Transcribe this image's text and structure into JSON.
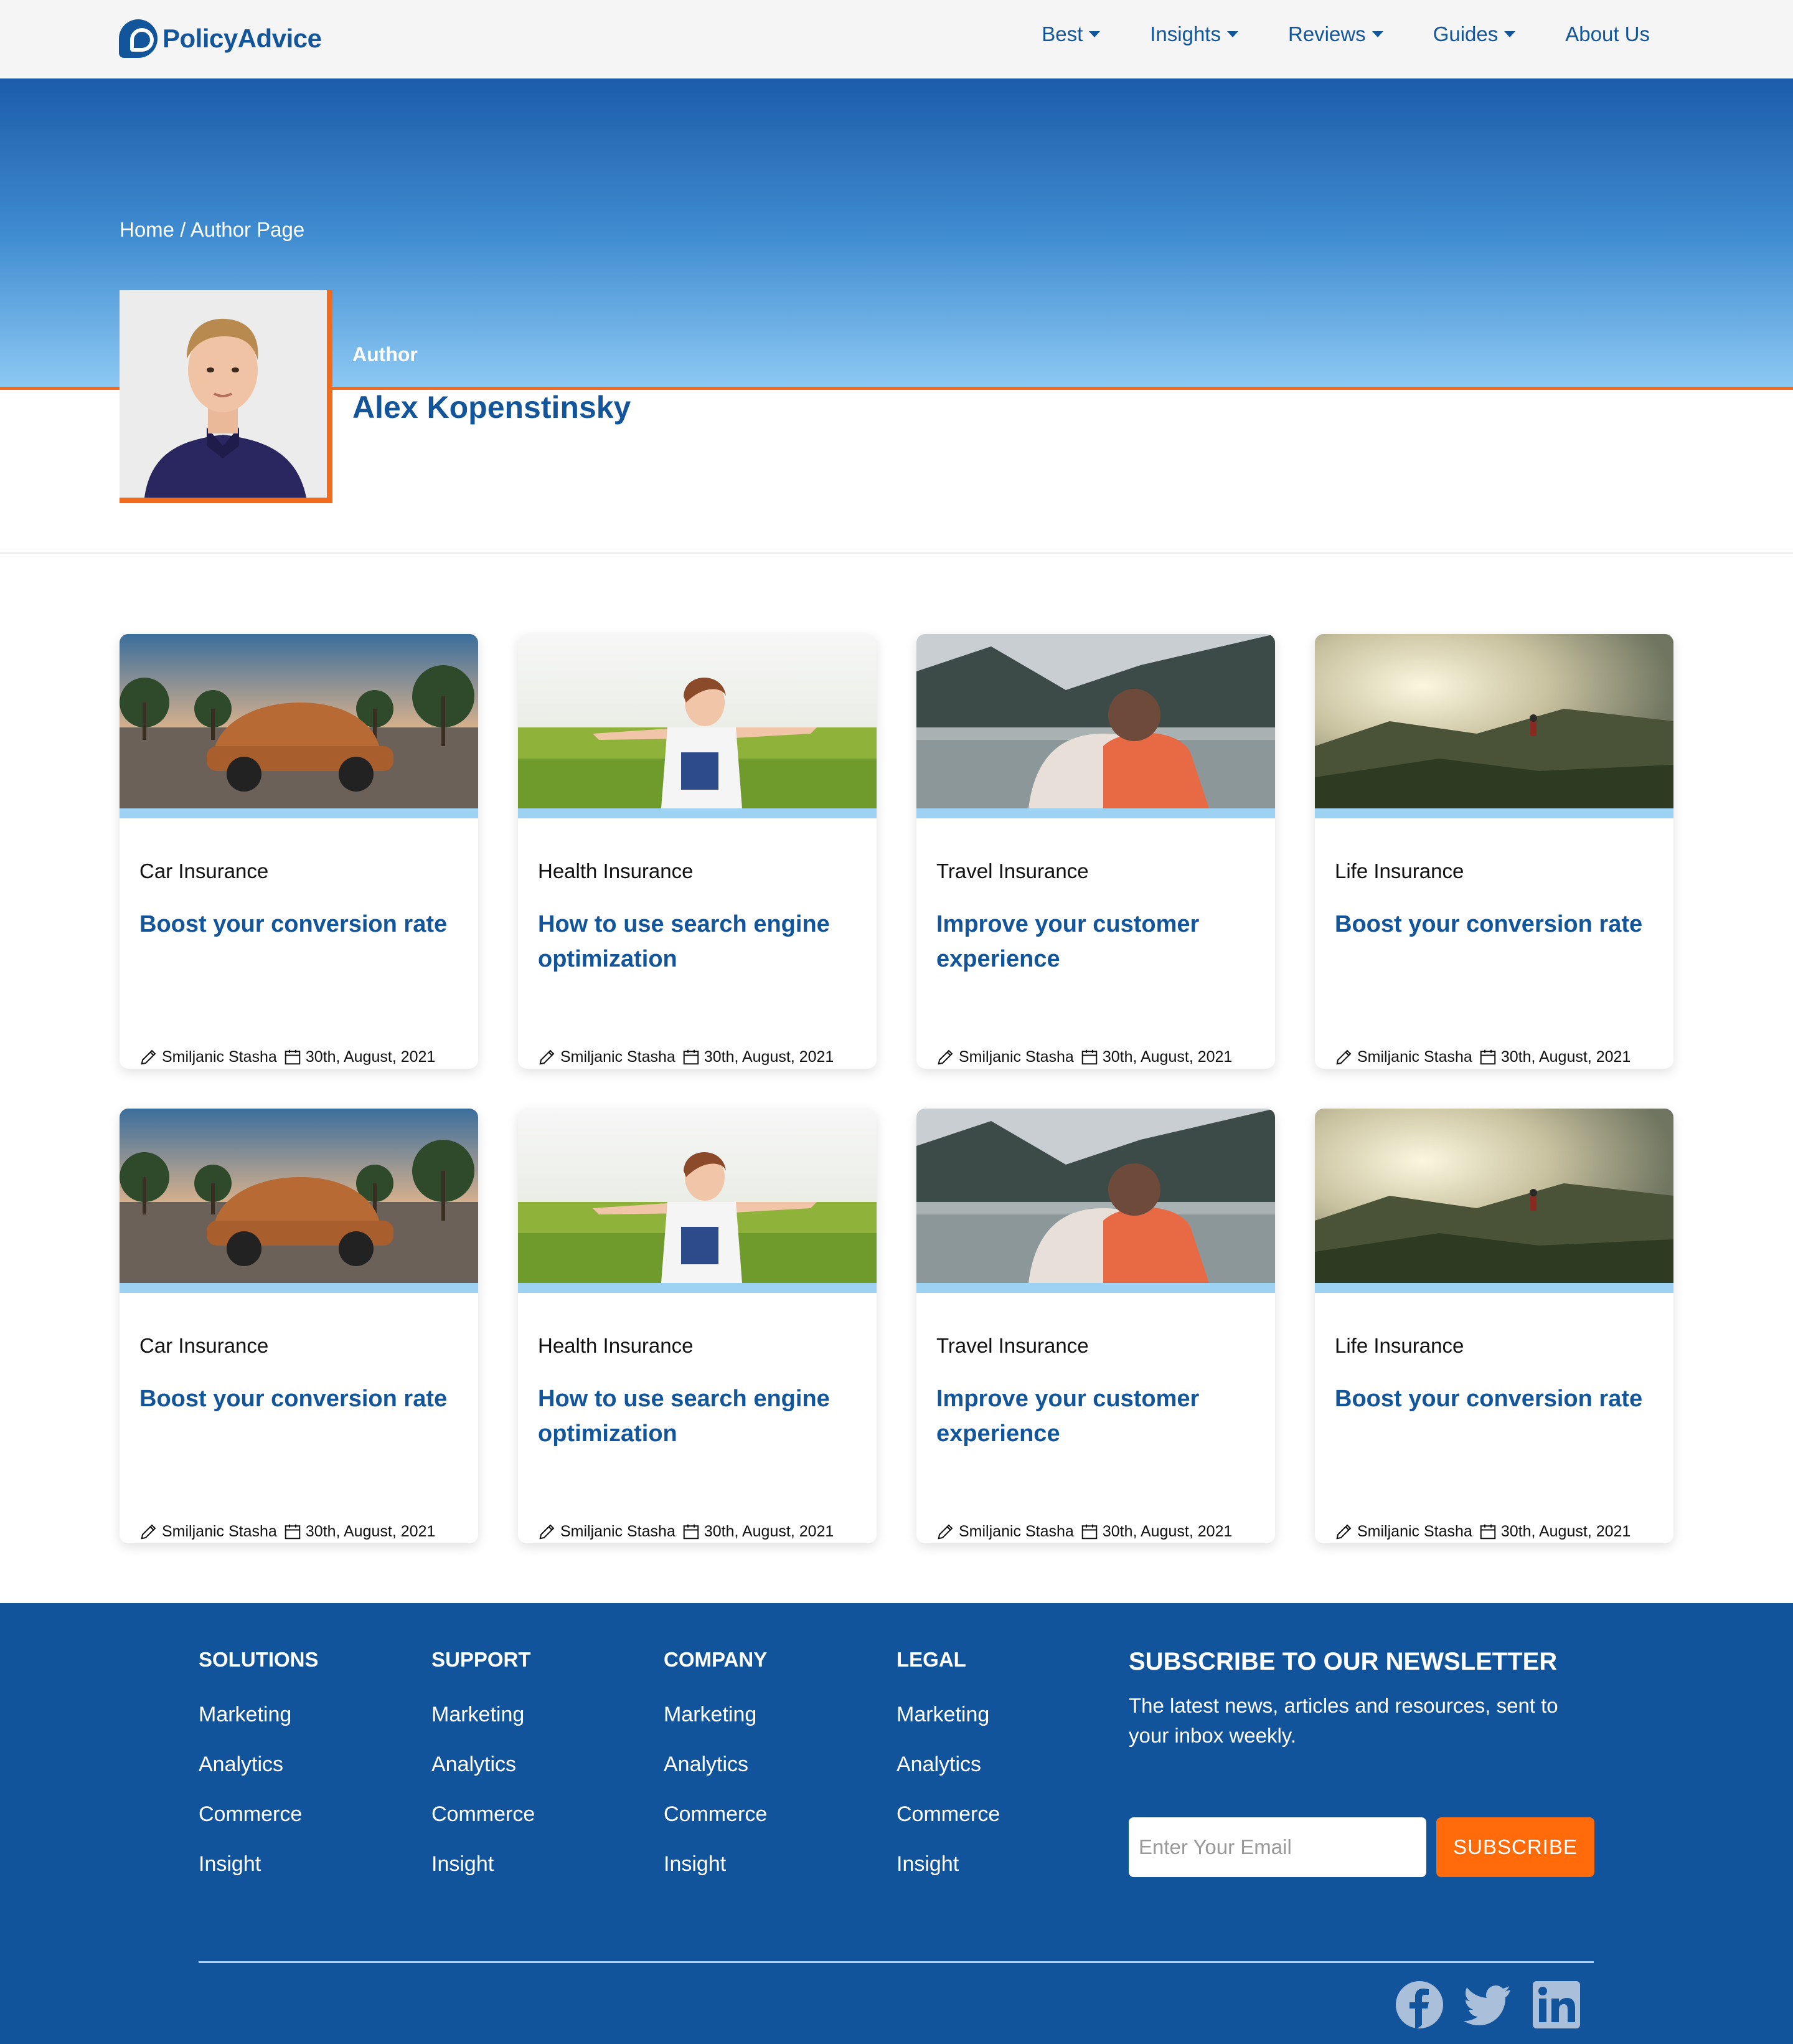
{
  "header": {
    "logo_text": "PolicyAdvice",
    "nav": [
      {
        "label": "Best",
        "has_dropdown": true
      },
      {
        "label": "Insights",
        "has_dropdown": true
      },
      {
        "label": "Reviews",
        "has_dropdown": true
      },
      {
        "label": "Guides",
        "has_dropdown": true
      },
      {
        "label": "About Us",
        "has_dropdown": false
      }
    ]
  },
  "hero": {
    "breadcrumb": "Home / Author Page",
    "author_label": "Author",
    "author_name": "Alex Kopenstinsky"
  },
  "cards": [
    {
      "category": "Car Insurance",
      "title": "Boost your conversion rate",
      "author": "Smiljanic Stasha",
      "date": "30th, August, 2021"
    },
    {
      "category": "Health Insurance",
      "title": "How to use search engine optimization",
      "author": "Smiljanic Stasha",
      "date": "30th, August, 2021"
    },
    {
      "category": "Travel Insurance",
      "title": "Improve your customer experience",
      "author": "Smiljanic Stasha",
      "date": "30th, August, 2021"
    },
    {
      "category": "Life Insurance",
      "title": "Boost your conversion rate",
      "author": "Smiljanic Stasha",
      "date": "30th, August, 2021"
    },
    {
      "category": "Car Insurance",
      "title": "Boost your conversion rate",
      "author": "Smiljanic Stasha",
      "date": "30th, August, 2021"
    },
    {
      "category": "Health Insurance",
      "title": "How to use search engine optimization",
      "author": "Smiljanic Stasha",
      "date": "30th, August, 2021"
    },
    {
      "category": "Travel Insurance",
      "title": "Improve your customer experience",
      "author": "Smiljanic Stasha",
      "date": "30th, August, 2021"
    },
    {
      "category": "Life Insurance",
      "title": "Boost your conversion rate",
      "author": "Smiljanic Stasha",
      "date": "30th, August, 2021"
    }
  ],
  "footer": {
    "columns": [
      {
        "heading": "SOLUTIONS",
        "items": [
          "Marketing",
          "Analytics",
          "Commerce",
          "Insight"
        ]
      },
      {
        "heading": "SUPPORT",
        "items": [
          "Marketing",
          "Analytics",
          "Commerce",
          "Insight"
        ]
      },
      {
        "heading": "COMPANY",
        "items": [
          "Marketing",
          "Analytics",
          "Commerce",
          "Insight"
        ]
      },
      {
        "heading": "LEGAL",
        "items": [
          "Marketing",
          "Analytics",
          "Commerce",
          "Insight"
        ]
      }
    ],
    "newsletter": {
      "heading": "SUBSCRIBE TO OUR NEWSLETTER",
      "subtext": "The latest news, articles and resources, sent to your inbox weekly.",
      "email_placeholder": "Enter Your Email",
      "button_label": "SUBSCRIBE"
    },
    "social_icons": [
      "facebook-icon",
      "twitter-icon",
      "linkedin-icon"
    ]
  },
  "colors": {
    "brand_blue": "#13559b",
    "accent_orange": "#f26b1d",
    "card_bar": "#9dd2f3",
    "footer_bg": "#12549b"
  }
}
